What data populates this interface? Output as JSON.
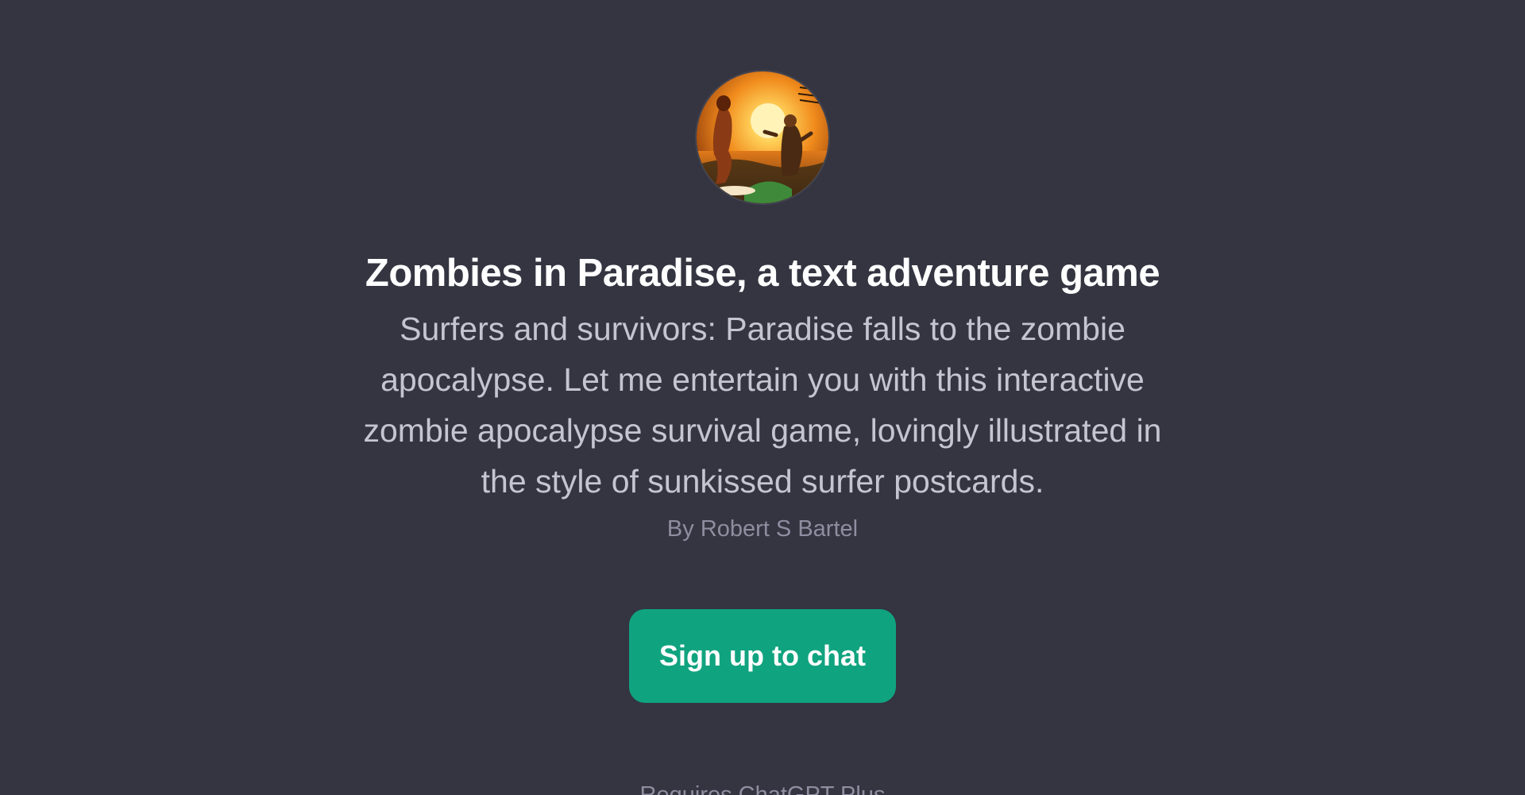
{
  "gpt": {
    "avatar_icon": "zombies-in-paradise-illustration",
    "title": "Zombies in Paradise, a text adventure game",
    "description": "Surfers and survivors: Paradise falls to the zombie apocalypse. Let me entertain you with this interactive zombie apocalypse survival game, lovingly illustrated in the style of sunkissed surfer postcards.",
    "author": "By Robert S Bartel"
  },
  "actions": {
    "signup_label": "Sign up to chat"
  },
  "footer": {
    "note": "Requires ChatGPT Plus"
  },
  "colors": {
    "background": "#343541",
    "title": "#ffffff",
    "description": "#c5c5d2",
    "author": "#8e8ea0",
    "accent": "#10a37f"
  }
}
